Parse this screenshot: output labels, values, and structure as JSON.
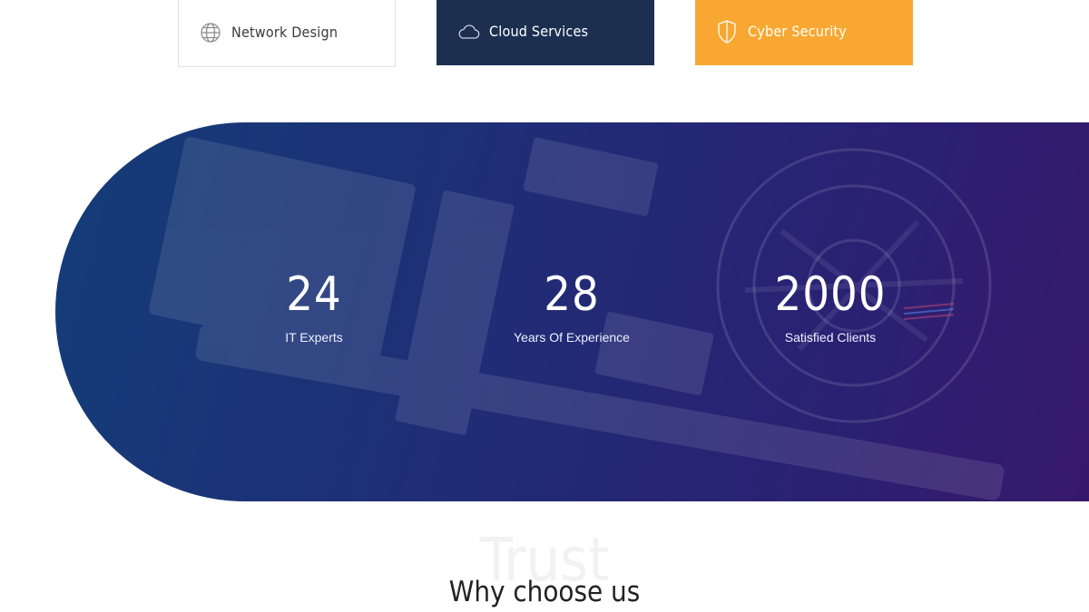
{
  "services": [
    {
      "label": "Network Design",
      "icon": "globe-icon"
    },
    {
      "label": "Cloud Services",
      "icon": "cloud-icon"
    },
    {
      "label": "Cyber Security",
      "icon": "shield-icon"
    }
  ],
  "stats": [
    {
      "value": "24",
      "caption": "IT Experts"
    },
    {
      "value": "28",
      "caption": "Years Of Experience"
    },
    {
      "value": "2000",
      "caption": "Satisfied Clients"
    }
  ],
  "section": {
    "watermark": "Trust",
    "title": "Why choose us"
  },
  "colors": {
    "navy": "#1c2f50",
    "orange": "#f8a832",
    "gradient_start": "#143d78",
    "gradient_end": "#3a1668"
  }
}
